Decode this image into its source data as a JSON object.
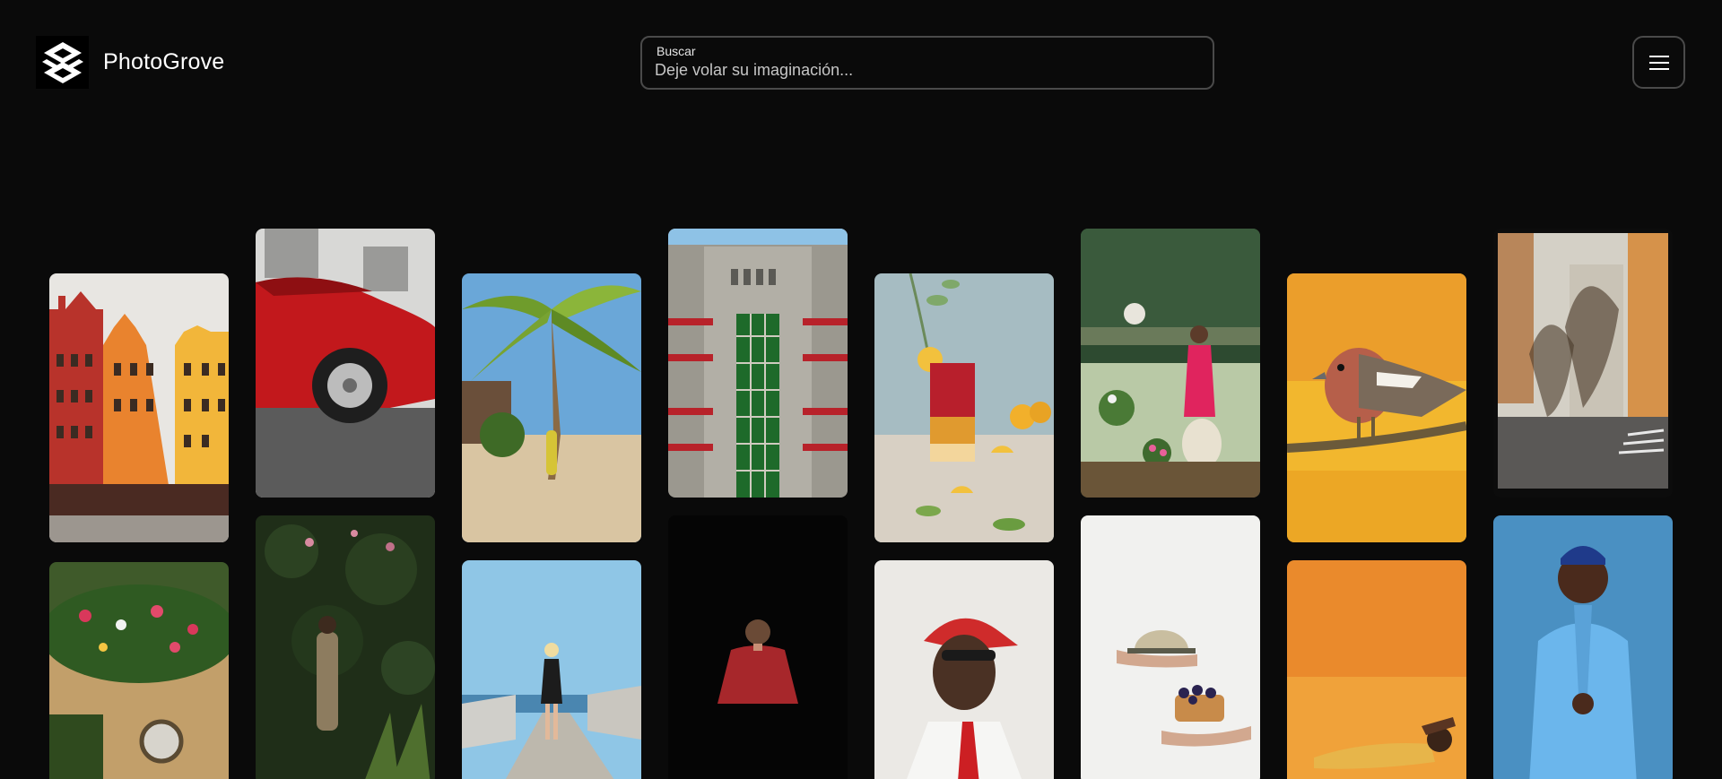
{
  "app": {
    "name": "PhotoGrove"
  },
  "search": {
    "label": "Buscar",
    "placeholder": "Deje volar su imaginación..."
  },
  "photos": [
    {
      "subject": "Colorful Stockholm townhouses"
    },
    {
      "subject": "Red classic car close-up"
    },
    {
      "subject": "Woman under palm trees on beach"
    },
    {
      "subject": "1950 building facade with red windows"
    },
    {
      "subject": "Red layered cocktail with lemons"
    },
    {
      "subject": "Woman in pink with dog among flowers"
    },
    {
      "subject": "Chaffinch bird on branch"
    },
    {
      "subject": "Empty city street with trees"
    },
    {
      "subject": "Vintage car covered with flowers"
    },
    {
      "subject": "Man standing by ivy wall"
    },
    {
      "subject": "Woman walking on seaside path"
    },
    {
      "subject": "Person in red jacket on black background"
    },
    {
      "subject": "Portrait with red cap and sunglasses"
    },
    {
      "subject": "Hand holding dessert and dish"
    },
    {
      "subject": "Woman lying on orange backdrop"
    },
    {
      "subject": "Man in blue traditional outfit"
    }
  ],
  "colors": {
    "background": "#0a0a0a",
    "border": "#4a4a4a",
    "text": "#ffffff"
  }
}
